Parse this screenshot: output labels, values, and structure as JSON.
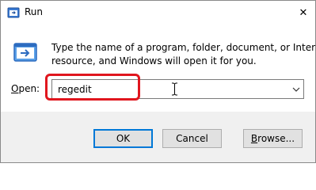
{
  "window": {
    "title": "Run",
    "close_symbol": "✕"
  },
  "message": {
    "line1": "Type the name of a program, folder, document, or Internet",
    "line2": "resource, and Windows will open it for you."
  },
  "open_field": {
    "label_mnemonic": "O",
    "label_rest": "pen:",
    "value": "regedit"
  },
  "buttons": {
    "ok": "OK",
    "cancel": "Cancel",
    "browse_mnemonic": "B",
    "browse_rest": "rowse..."
  },
  "colors": {
    "highlight": "#e0161e",
    "accent": "#0078d7",
    "footer_bg": "#f0f0f0"
  },
  "icons": [
    "run-app-icon",
    "close-icon",
    "run-program-icon",
    "text-cursor-icon",
    "chevron-down-icon"
  ]
}
